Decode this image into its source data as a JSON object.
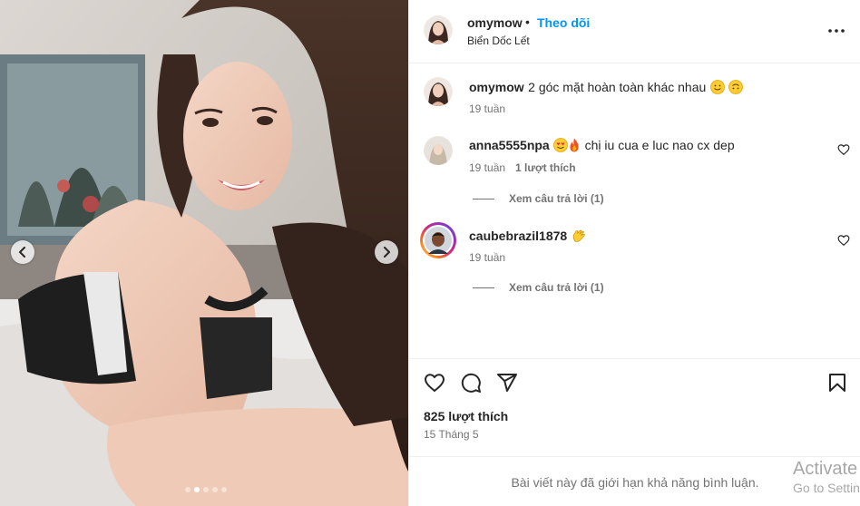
{
  "post": {
    "author": "omymow",
    "separator": "•",
    "follow_label": "Theo dõi",
    "location": "Biển Dốc Lết",
    "caption": {
      "username": "omymow",
      "text": "2 góc mặt hoàn toàn khác nhau",
      "time": "19 tuần"
    },
    "media": {
      "slide_count": 5,
      "active_slide": 2
    }
  },
  "comments": [
    {
      "username": "anna5555npa",
      "text": "chị iu cua e luc nao cx dep",
      "time": "19 tuần",
      "likes": "1 lượt thích",
      "view_replies": "Xem câu trả lời (1)"
    },
    {
      "username": "caubebrazil1878",
      "text": "",
      "time": "19 tuần",
      "view_replies": "Xem câu trả lời (1)"
    }
  ],
  "footer": {
    "like_count": "825 lượt thích",
    "date": "15 Tháng 5",
    "comments_limited": "Bài viết này đã giới hạn khả năng bình luận."
  },
  "watermark": {
    "line1": "Activate",
    "line2": "Go to Settin"
  },
  "icons": {
    "more": "more-horizontal-icon",
    "like": "heart-icon",
    "comment": "comment-icon",
    "share": "share-icon",
    "save": "bookmark-icon"
  },
  "colors": {
    "link_blue": "#0095f6",
    "text": "#262626",
    "muted": "#737373",
    "divider": "#efefef"
  }
}
